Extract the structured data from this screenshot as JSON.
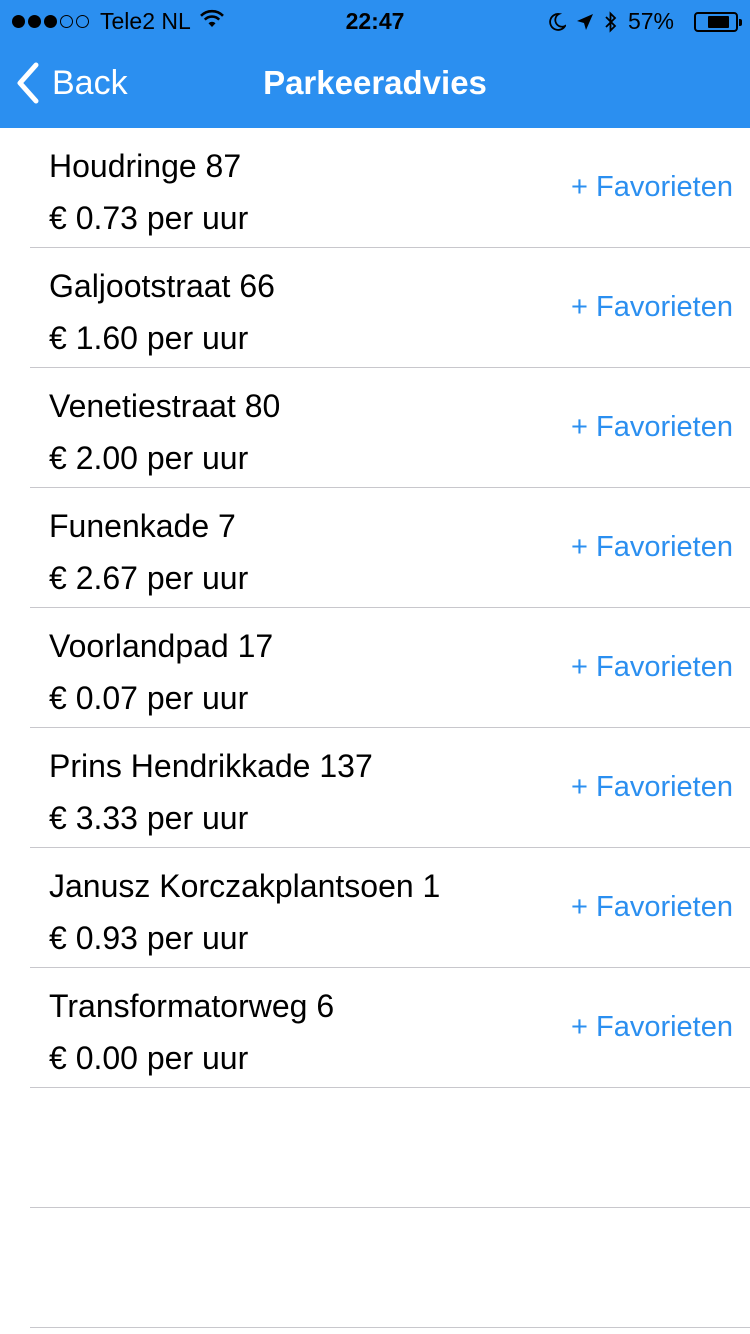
{
  "status_bar": {
    "carrier": "Tele2 NL",
    "time": "22:47",
    "battery": "57%",
    "battery_level": 0.57,
    "signal_bars": 3,
    "signal_total": 5
  },
  "navbar": {
    "back_label": "Back",
    "title": "Parkeeradvies",
    "color": "#2b8ff0"
  },
  "items": [
    {
      "name": "Houdringe 87",
      "price": "€ 0.73 per uur",
      "fav": "+ Favorieten"
    },
    {
      "name": "Galjootstraat 66",
      "price": "€ 1.60 per uur",
      "fav": "+ Favorieten"
    },
    {
      "name": "Venetiestraat 80",
      "price": "€ 2.00 per uur",
      "fav": "+ Favorieten"
    },
    {
      "name": "Funenkade 7",
      "price": "€ 2.67 per uur",
      "fav": "+ Favorieten"
    },
    {
      "name": "Voorlandpad 17",
      "price": "€ 0.07 per uur",
      "fav": "+ Favorieten"
    },
    {
      "name": "Prins Hendrikkade 137",
      "price": "€ 3.33 per uur",
      "fav": "+ Favorieten"
    },
    {
      "name": "Janusz Korczakplantsoen 1",
      "price": "€ 0.93 per uur",
      "fav": "+ Favorieten"
    },
    {
      "name": "Transformatorweg 6",
      "price": "€ 0.00 per uur",
      "fav": "+ Favorieten"
    }
  ]
}
